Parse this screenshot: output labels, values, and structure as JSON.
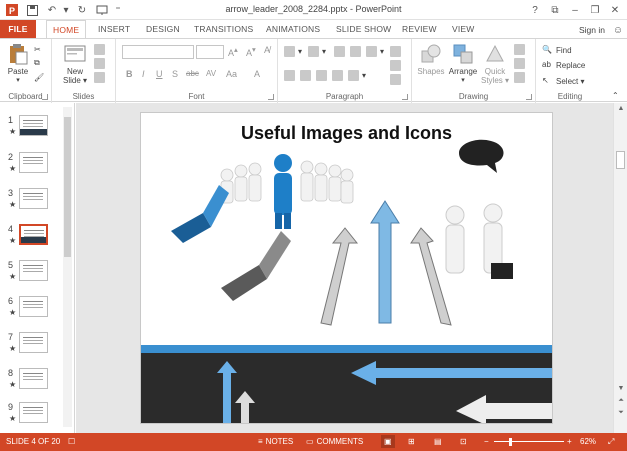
{
  "window": {
    "title": "arrow_leader_2008_2284.pptx - PowerPoint"
  },
  "tabs": [
    "FILE",
    "HOME",
    "INSERT",
    "DESIGN",
    "TRANSITIONS",
    "ANIMATIONS",
    "SLIDE SHOW",
    "REVIEW",
    "VIEW"
  ],
  "account": {
    "sign_in": "Sign in"
  },
  "ribbon": {
    "clipboard": {
      "label": "Clipboard",
      "paste": "Paste"
    },
    "slides": {
      "label": "Slides",
      "new_slide_1": "New",
      "new_slide_2": "Slide ▾"
    },
    "font": {
      "label": "Font",
      "bold": "B",
      "italic": "I",
      "underline": "U",
      "strike": "S",
      "shadow": "abc",
      "spacing": "AV",
      "case": "Aa",
      "color": "A"
    },
    "paragraph": {
      "label": "Paragraph"
    },
    "drawing": {
      "label": "Drawing",
      "shapes": "Shapes",
      "arrange": "Arrange",
      "quick_styles_1": "Quick",
      "quick_styles_2": "Styles ▾"
    },
    "editing": {
      "label": "Editing",
      "find": "Find",
      "replace": "Replace",
      "select": "Select ▾"
    }
  },
  "thumbnails": [
    {
      "num": "1",
      "star": "★"
    },
    {
      "num": "2",
      "star": "★"
    },
    {
      "num": "3",
      "star": "★"
    },
    {
      "num": "4",
      "star": "★"
    },
    {
      "num": "5",
      "star": "★"
    },
    {
      "num": "6",
      "star": "★"
    },
    {
      "num": "7",
      "star": "★"
    },
    {
      "num": "8",
      "star": "★"
    },
    {
      "num": "9",
      "star": "★"
    }
  ],
  "slide": {
    "title": "Useful Images and Icons"
  },
  "status": {
    "slide_of": "SLIDE 4 OF 20",
    "notes": "NOTES",
    "comments": "COMMENTS",
    "zoom": "62%",
    "minus": "−",
    "plus": "+"
  },
  "colors": {
    "accent": "#d24726",
    "blue_figure": "#1e7fc8",
    "slide_band": "#2b2b2b"
  }
}
